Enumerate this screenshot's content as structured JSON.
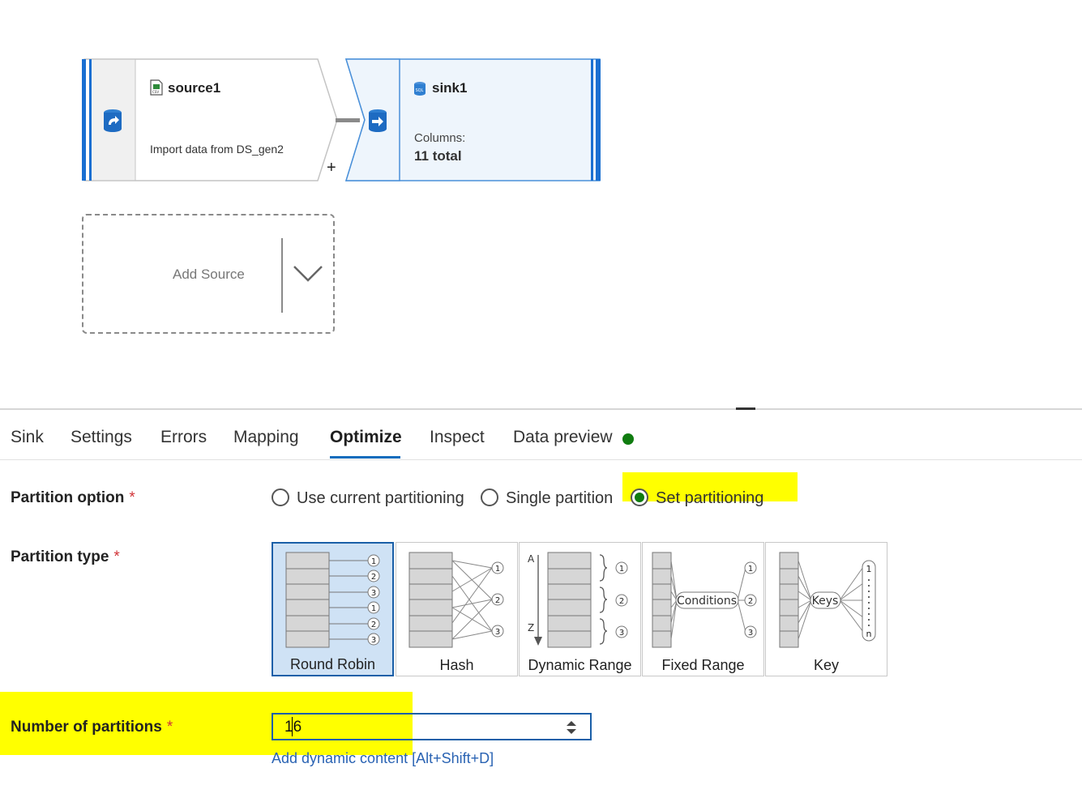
{
  "canvas": {
    "source_node": {
      "name": "source1",
      "description": "Import data from DS_gen2",
      "icon": "csv-file-icon",
      "add_symbol": "+"
    },
    "sink_node": {
      "name": "sink1",
      "columns_label": "Columns:",
      "columns_value": "11 total",
      "icon": "sql-icon"
    },
    "add_source": {
      "label": "Add Source"
    }
  },
  "tabs": [
    {
      "label": "Sink"
    },
    {
      "label": "Settings"
    },
    {
      "label": "Errors"
    },
    {
      "label": "Mapping"
    },
    {
      "label": "Optimize"
    },
    {
      "label": "Inspect"
    },
    {
      "label": "Data preview"
    }
  ],
  "active_tab": "Optimize",
  "data_preview_status_color": "#107c10",
  "form": {
    "partition_option": {
      "label": "Partition option",
      "required_mark": "*",
      "options": [
        {
          "label": "Use current partitioning",
          "checked": false
        },
        {
          "label": "Single partition",
          "checked": false
        },
        {
          "label": "Set partitioning",
          "checked": true
        }
      ]
    },
    "partition_type": {
      "label": "Partition type",
      "required_mark": "*",
      "selected": "Round Robin",
      "options": [
        {
          "label": "Round Robin",
          "glyphs": [
            "1",
            "2",
            "3",
            "1",
            "2",
            "3"
          ]
        },
        {
          "label": "Hash",
          "glyphs": [
            "1",
            "2",
            "3"
          ]
        },
        {
          "label": "Dynamic Range",
          "glyphs": [
            "A",
            "Z",
            "1",
            "2",
            "3"
          ]
        },
        {
          "label": "Fixed Range",
          "glyphs": [
            "Conditions",
            "1",
            "2",
            "3"
          ]
        },
        {
          "label": "Key",
          "glyphs": [
            "Keys",
            "1",
            "n"
          ]
        }
      ]
    },
    "number_of_partitions": {
      "label": "Number of partitions",
      "required_mark": "*",
      "value": "16"
    },
    "dynamic_content_link": "Add dynamic content [Alt+Shift+D]"
  },
  "colors": {
    "accent": "#0f6cbd",
    "highlight": "#ffff00",
    "selected_card": "#cfe2f5",
    "link": "#2a63b3"
  }
}
